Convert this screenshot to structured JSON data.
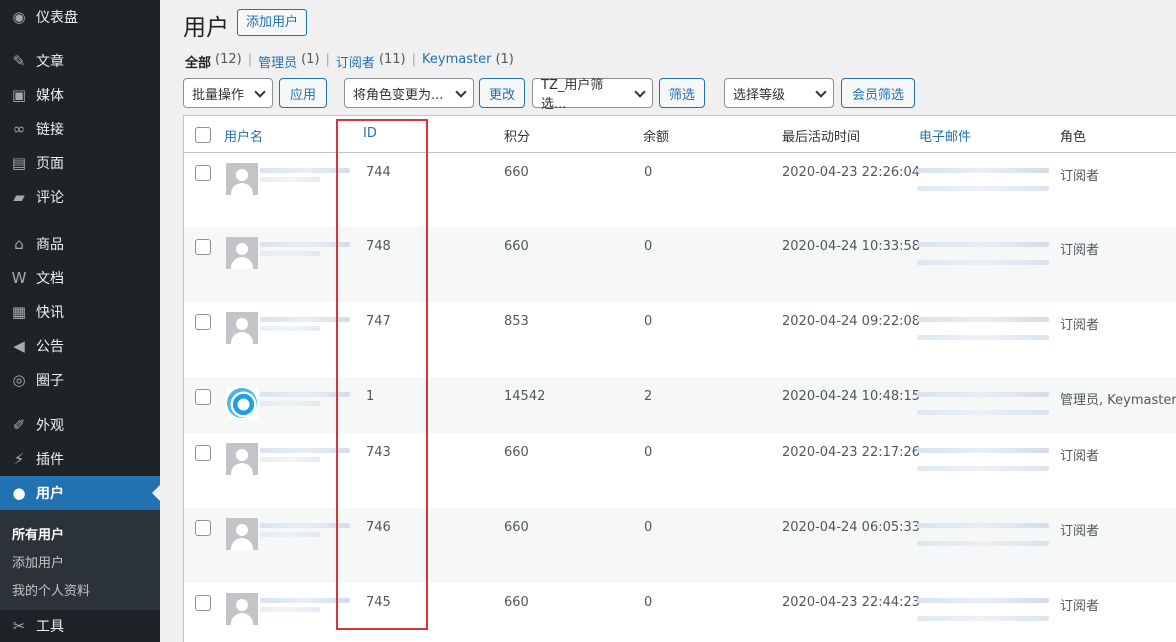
{
  "sidebar": {
    "items": [
      {
        "label": "仪表盘",
        "icon": "dashboard-icon",
        "glyph": "◉"
      },
      {
        "label": "文章",
        "icon": "pin-icon",
        "glyph": "✎"
      },
      {
        "label": "媒体",
        "icon": "media-icon",
        "glyph": "▣"
      },
      {
        "label": "链接",
        "icon": "link-icon",
        "glyph": "∞"
      },
      {
        "label": "页面",
        "icon": "page-icon",
        "glyph": "▤"
      },
      {
        "label": "评论",
        "icon": "comment-icon",
        "glyph": "▰"
      },
      {
        "label": "商品",
        "icon": "store-icon",
        "glyph": "⌂"
      },
      {
        "label": "文档",
        "icon": "document-icon",
        "glyph": "W"
      },
      {
        "label": "快讯",
        "icon": "news-icon",
        "glyph": "▦"
      },
      {
        "label": "公告",
        "icon": "megaphone-icon",
        "glyph": "◀"
      },
      {
        "label": "圈子",
        "icon": "circle-group-icon",
        "glyph": "◎"
      },
      {
        "label": "外观",
        "icon": "appearance-icon",
        "glyph": "✐"
      },
      {
        "label": "插件",
        "icon": "plugin-icon",
        "glyph": "⚡"
      },
      {
        "label": "用户",
        "icon": "user-icon",
        "glyph": "●"
      },
      {
        "label": "工具",
        "icon": "tools-icon",
        "glyph": "✂"
      }
    ],
    "submenu": [
      "所有用户",
      "添加用户",
      "我的个人资料"
    ]
  },
  "header": {
    "title": "用户",
    "add_new": "添加用户"
  },
  "filters": [
    {
      "label": "全部",
      "count": "(12)"
    },
    {
      "label": "管理员",
      "count": "(1)"
    },
    {
      "label": "订阅者",
      "count": "(11)"
    },
    {
      "label": "Keymaster",
      "count": "(1)"
    }
  ],
  "toolbar": {
    "bulk_action": "批量操作",
    "apply": "应用",
    "change_role": "将角色变更为...",
    "change": "更改",
    "tz_filter": "TZ_用户筛选...",
    "filter": "筛选",
    "select_level": "选择等级",
    "member_filter": "会员筛选"
  },
  "table": {
    "columns": [
      "用户名",
      "ID",
      "积分",
      "余额",
      "最后活动时间",
      "电子邮件",
      "角色"
    ],
    "rows": [
      {
        "id": "744",
        "points": "660",
        "balance": "0",
        "last_active": "2020-04-23 22:26:04",
        "role": "订阅者",
        "avatar": "default"
      },
      {
        "id": "748",
        "points": "660",
        "balance": "0",
        "last_active": "2020-04-24 10:33:58",
        "role": "订阅者",
        "avatar": "default"
      },
      {
        "id": "747",
        "points": "853",
        "balance": "0",
        "last_active": "2020-04-24 09:22:08",
        "role": "订阅者",
        "avatar": "default"
      },
      {
        "id": "1",
        "points": "14542",
        "balance": "2",
        "last_active": "2020-04-24 10:48:15",
        "role": "管理员, Keymaster",
        "avatar": "swirl"
      },
      {
        "id": "743",
        "points": "660",
        "balance": "0",
        "last_active": "2020-04-23 22:17:26",
        "role": "订阅者",
        "avatar": "default"
      },
      {
        "id": "746",
        "points": "660",
        "balance": "0",
        "last_active": "2020-04-24 06:05:33",
        "role": "订阅者",
        "avatar": "default"
      },
      {
        "id": "745",
        "points": "660",
        "balance": "0",
        "last_active": "2020-04-23 22:44:23",
        "role": "订阅者",
        "avatar": "default"
      }
    ]
  },
  "colors": {
    "accent": "#2271b1",
    "highlight": "#d63638",
    "sidebar": "#1d2327"
  }
}
